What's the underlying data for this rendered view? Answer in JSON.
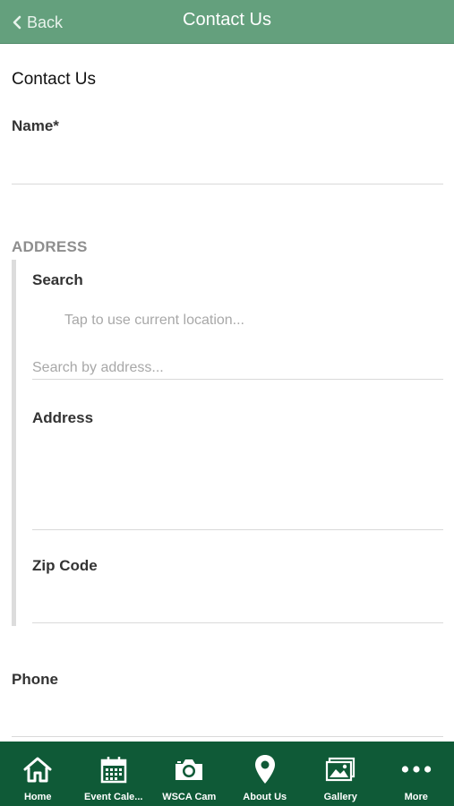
{
  "header": {
    "back_label": "Back",
    "title": "Contact Us"
  },
  "form": {
    "title": "Contact Us",
    "name_label": "Name*",
    "address_section": "ADDRESS",
    "search_label": "Search",
    "current_location_link": "Tap to use current location...",
    "search_placeholder": "Search by address...",
    "address_label": "Address",
    "zip_label": "Zip Code",
    "phone_label": "Phone"
  },
  "tabs": [
    {
      "label": "Home",
      "icon": "home-icon"
    },
    {
      "label": "Event Cale...",
      "icon": "calendar-icon"
    },
    {
      "label": "WSCA Cam",
      "icon": "camera-icon"
    },
    {
      "label": "About Us",
      "icon": "location-pin-icon"
    },
    {
      "label": "Gallery",
      "icon": "gallery-icon"
    },
    {
      "label": "More",
      "icon": "more-icon"
    }
  ],
  "colors": {
    "header_bg": "#64a07d",
    "tabbar_bg": "#0f5a37"
  }
}
